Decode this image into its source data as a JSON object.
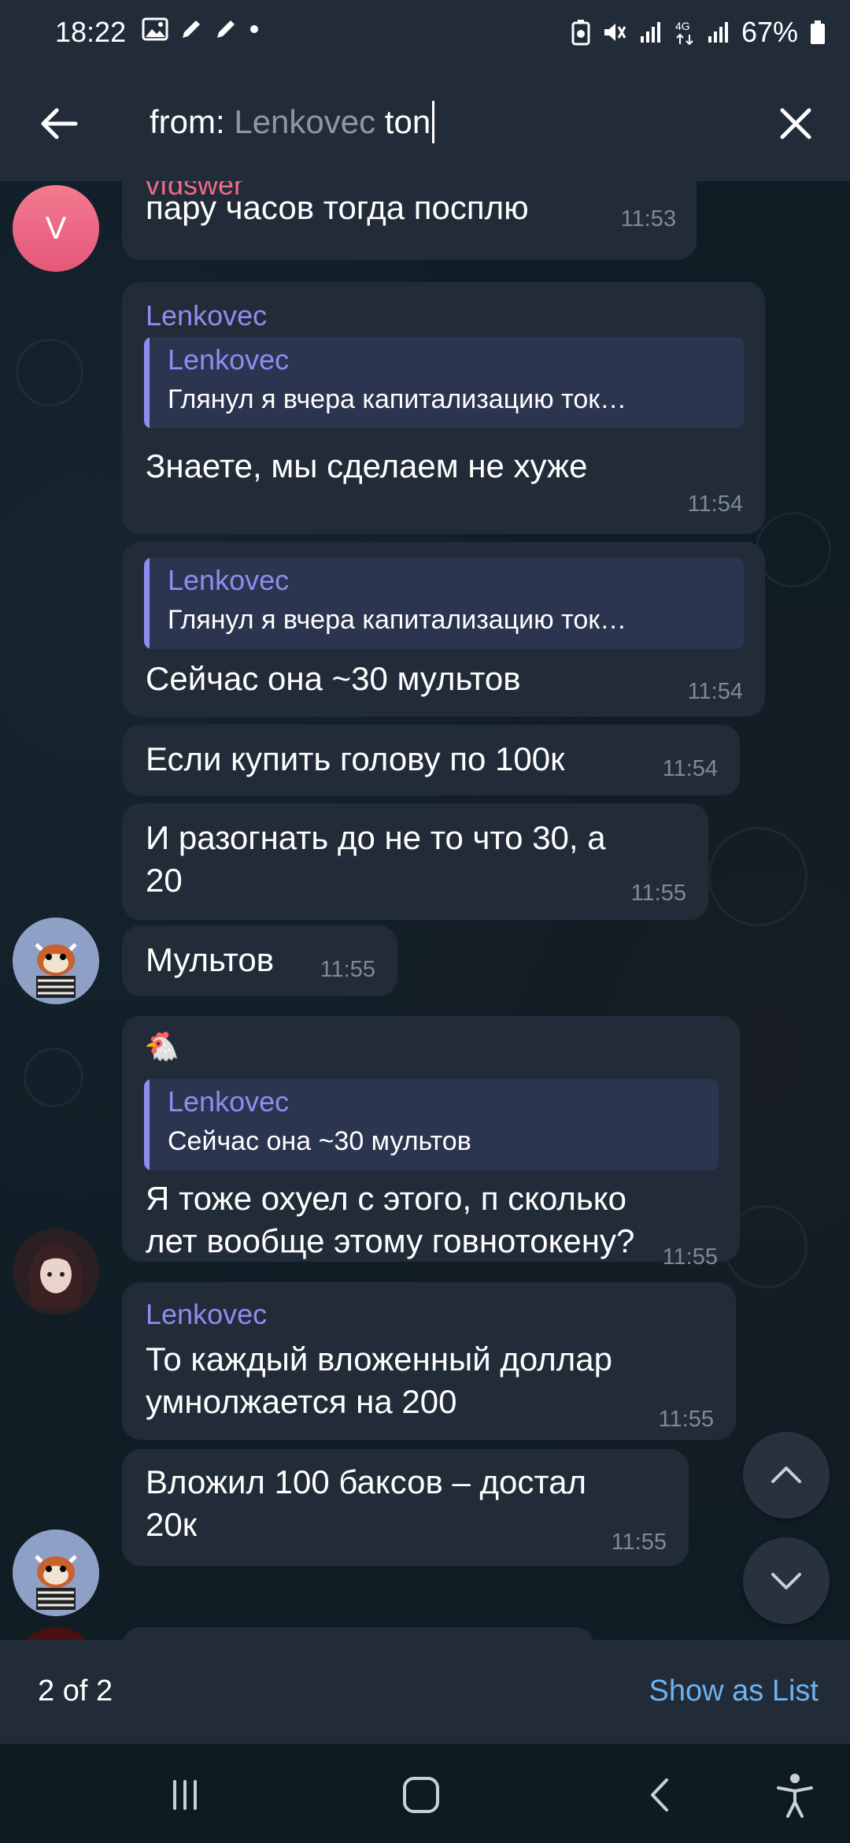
{
  "status_bar": {
    "time": "18:22",
    "battery": "67%"
  },
  "search": {
    "prefix": "from: ",
    "user_chip": "Lenkovec",
    "query": " ton"
  },
  "messages": [
    {
      "sender": "vfdswer",
      "text": "пару часов тогда посплю",
      "time": "11:53",
      "avatar_letter": "V"
    },
    {
      "sender": "Lenkovec",
      "reply_name": "Lenkovec",
      "reply_text": "Глянул я вчера капитализацию ток…",
      "text": "Знаете, мы сделаем не хуже",
      "time": "11:54"
    },
    {
      "reply_name": "Lenkovec",
      "reply_text": "Глянул я вчера капитализацию ток…",
      "text": "Сейчас она ~30 мультов",
      "time": "11:54"
    },
    {
      "text": "Если купить голову по 100к",
      "time": "11:54"
    },
    {
      "text_line1": "И разогнать до не то что 30, а",
      "text_line2": "20",
      "time": "11:55"
    },
    {
      "text": "Мультов",
      "time": "11:55"
    },
    {
      "sender_emoji": "🐔",
      "reply_name": "Lenkovec",
      "reply_text": "Сейчас она ~30 мультов",
      "text_line1": "Я тоже охуел с этого, п сколько",
      "text_line2": "лет вообще этому говнотокену?",
      "time": "11:55"
    },
    {
      "sender": "Lenkovec",
      "text_line1": "То каждый вложенный доллар",
      "text_line2": "умнолжается на 200",
      "time": "11:55"
    },
    {
      "text_line1": "Вложил 100 баксов – достал",
      "text_line2": "20к",
      "time": "11:55"
    }
  ],
  "bottom_bar": {
    "counter": "2 of 2",
    "show_as_list": "Show as List"
  },
  "colors": {
    "header_bg": "#222c38",
    "bubble_bg": "#222c38",
    "sender_name": "#8f8cf0",
    "link": "#6db3f2",
    "avatar_v": "#e5577a"
  }
}
